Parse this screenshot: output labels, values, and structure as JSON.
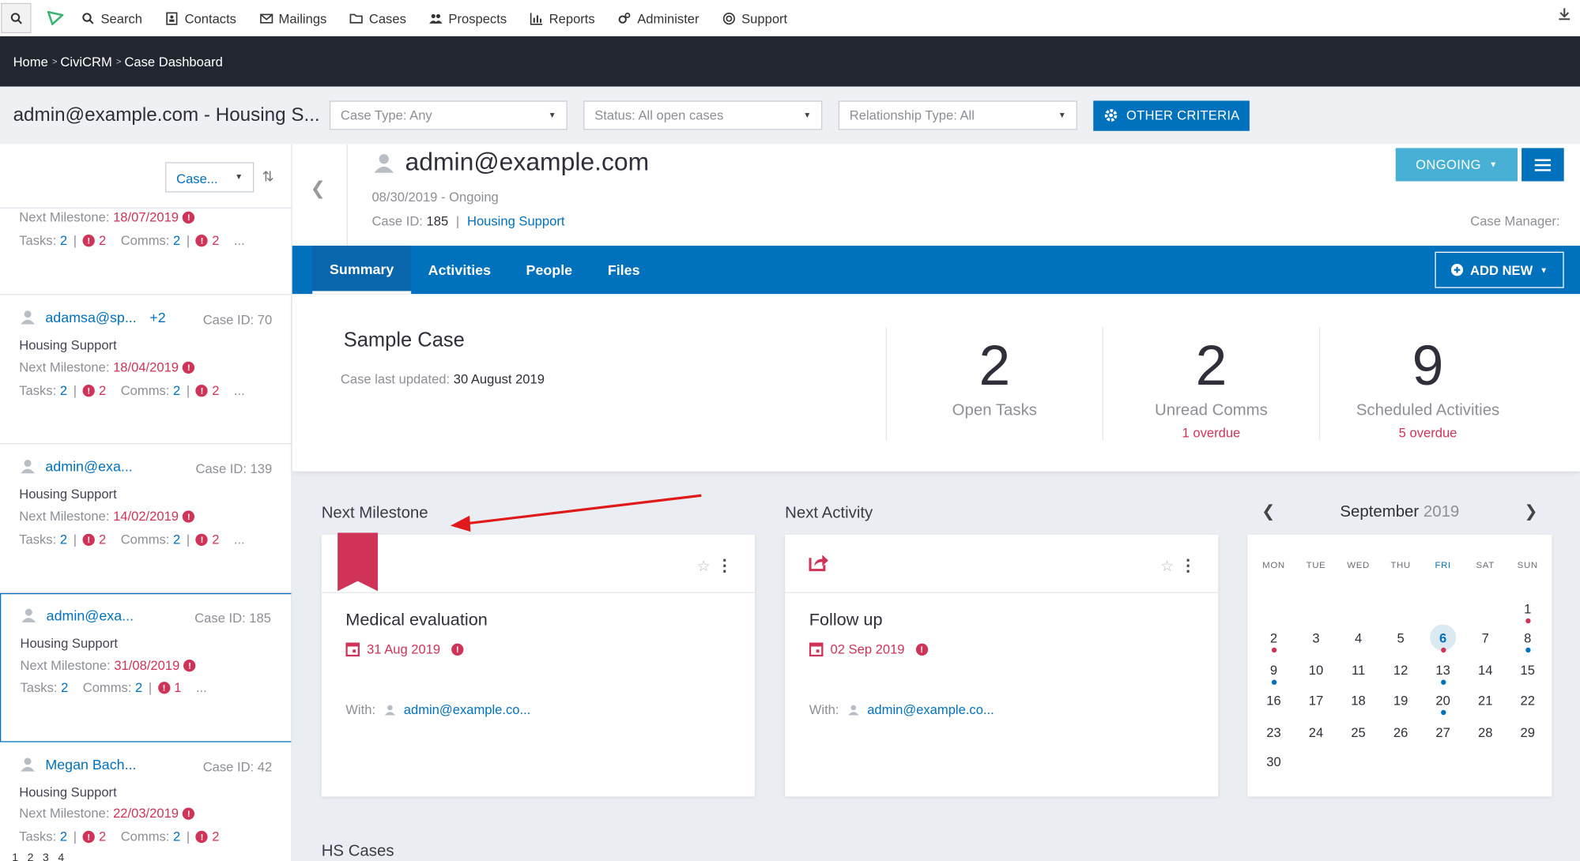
{
  "menu": {
    "items": [
      {
        "icon": "search-icon",
        "label": "Search"
      },
      {
        "icon": "contacts-icon",
        "label": "Contacts"
      },
      {
        "icon": "mail-icon",
        "label": "Mailings"
      },
      {
        "icon": "folder-icon",
        "label": "Cases"
      },
      {
        "icon": "users-icon",
        "label": "Prospects"
      },
      {
        "icon": "bar-chart-icon",
        "label": "Reports"
      },
      {
        "icon": "cogs-icon",
        "label": "Administer"
      },
      {
        "icon": "lifebuoy-icon",
        "label": "Support"
      }
    ]
  },
  "breadcrumb": {
    "items": [
      "Home",
      "CiviCRM",
      "Case Dashboard"
    ]
  },
  "filter_bar": {
    "title": "admin@example.com - Housing S...",
    "case_type": "Case Type: Any",
    "status": "Status: All open cases",
    "relationship": "Relationship Type: All",
    "criteria_button": "OTHER CRITERIA"
  },
  "sidebar": {
    "sort_label": "Case...",
    "cards": [
      {
        "name": "",
        "extra": "",
        "case_id": "",
        "type": "",
        "milestone_label": "Next Milestone:",
        "milestone_date": "18/07/2019",
        "tasks_label": "Tasks:",
        "tasks": "2",
        "tasks_overdue": "2",
        "comms_label": "Comms:",
        "comms": "2",
        "comms_overdue": "2",
        "more": "..."
      },
      {
        "name": "adamsa@sp...",
        "extra": "+2",
        "case_id": "Case ID: 70",
        "type": "Housing Support",
        "milestone_label": "Next Milestone:",
        "milestone_date": "18/04/2019",
        "tasks_label": "Tasks:",
        "tasks": "2",
        "tasks_overdue": "2",
        "comms_label": "Comms:",
        "comms": "2",
        "comms_overdue": "2",
        "more": "..."
      },
      {
        "name": "admin@exa...",
        "extra": "",
        "case_id": "Case ID: 139",
        "type": "Housing Support",
        "milestone_label": "Next Milestone:",
        "milestone_date": "14/02/2019",
        "tasks_label": "Tasks:",
        "tasks": "2",
        "tasks_overdue": "2",
        "comms_label": "Comms:",
        "comms": "2",
        "comms_overdue": "2",
        "more": "..."
      },
      {
        "name": "admin@exa...",
        "extra": "",
        "case_id": "Case ID: 185",
        "type": "Housing Support",
        "milestone_label": "Next Milestone:",
        "milestone_date": "31/08/2019",
        "tasks_label": "Tasks:",
        "tasks": "2",
        "tasks_overdue": "",
        "comms_label": "Comms:",
        "comms": "2",
        "comms_overdue": "1",
        "more": "..."
      },
      {
        "name": "Megan Bach...",
        "extra": "",
        "case_id": "Case ID: 42",
        "type": "Housing Support",
        "milestone_label": "Next Milestone:",
        "milestone_date": "22/03/2019",
        "tasks_label": "Tasks:",
        "tasks": "2",
        "tasks_overdue": "2",
        "comms_label": "Comms:",
        "comms": "2",
        "comms_overdue": "2",
        "more": "..."
      }
    ],
    "pager": "1 2 3 4"
  },
  "case": {
    "client": "admin@example.com",
    "date_status": "08/30/2019 - Ongoing",
    "case_id_label": "Case ID:",
    "case_id": "185",
    "case_type": "Housing Support",
    "status_button": "ONGOING",
    "case_manager_label": "Case Manager:"
  },
  "tabs": [
    "Summary",
    "Activities",
    "People",
    "Files"
  ],
  "add_new": "ADD NEW",
  "summary": {
    "title": "Sample Case",
    "updated_label": "Case last updated:",
    "updated_date": "30 August 2019",
    "stats": [
      {
        "value": "2",
        "label": "Open Tasks",
        "overdue": ""
      },
      {
        "value": "2",
        "label": "Unread Comms",
        "overdue": "1 overdue"
      },
      {
        "value": "9",
        "label": "Scheduled Activities",
        "overdue": "5 overdue"
      }
    ]
  },
  "next_milestone": {
    "heading": "Next Milestone",
    "title": "Medical evaluation",
    "date": "31 Aug 2019",
    "with_label": "With:",
    "with": "admin@example.co..."
  },
  "next_activity": {
    "heading": "Next Activity",
    "title": "Follow up",
    "date": "02 Sep 2019",
    "with_label": "With:",
    "with": "admin@example.co..."
  },
  "calendar": {
    "month": "September",
    "year": "2019",
    "weekdays": [
      "MON",
      "TUE",
      "WED",
      "THU",
      "FRI",
      "SAT",
      "SUN"
    ],
    "days": [
      "1",
      "2",
      "3",
      "4",
      "5",
      "6",
      "7",
      "8",
      "9",
      "10",
      "11",
      "12",
      "13",
      "14",
      "15",
      "16",
      "17",
      "18",
      "19",
      "20",
      "21",
      "22",
      "23",
      "24",
      "25",
      "26",
      "27",
      "28",
      "29",
      "30"
    ],
    "today": "6"
  },
  "hs_cases": "HS Cases",
  "colors": {
    "brand": "#0071bd",
    "danger": "#cf3458",
    "info": "#48b0d4",
    "dark": "#212631"
  }
}
